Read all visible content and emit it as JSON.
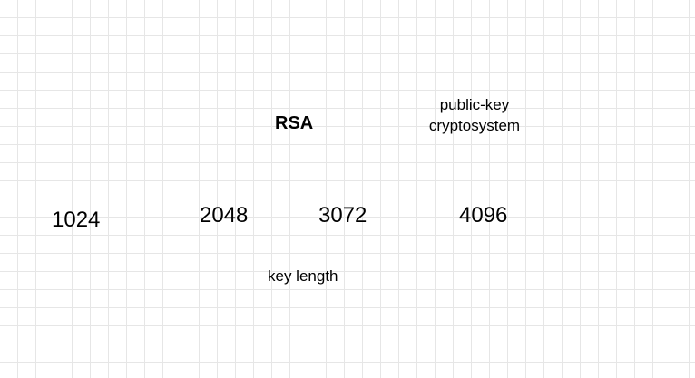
{
  "diagram": {
    "title": "RSA",
    "subtitle": "public-key cryptosystem",
    "key_sizes": [
      "1024",
      "2048",
      "3072",
      "4096"
    ],
    "axis_label": "key length"
  },
  "colors": {
    "background": "#ffffff",
    "grid": "#e6e6e6",
    "text": "#000000"
  }
}
